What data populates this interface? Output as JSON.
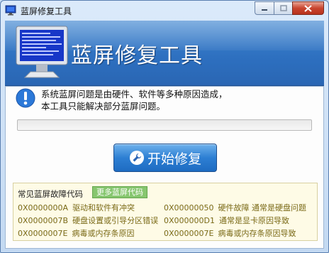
{
  "window": {
    "title": "蓝屏修复工具"
  },
  "banner": {
    "title": "蓝屏修复工具"
  },
  "info": {
    "line1": "系统蓝屏问题是由硬件、软件等多种原因造成，",
    "line2": "本工具只能解决部分蓝屏问题。"
  },
  "progress": {
    "value": 0
  },
  "start_button": {
    "label": "开始修复"
  },
  "codes": {
    "label": "常见蓝屏故障代码",
    "more_label": "更多蓝屏代码",
    "items": [
      {
        "code": "0X0000000A",
        "desc": "驱动和软件有冲突"
      },
      {
        "code": "0X00000050",
        "desc": "硬件故障 通常是硬盘问题"
      },
      {
        "code": "0X0000007B",
        "desc": "硬盘设置或引导分区错误"
      },
      {
        "code": "0X000000D1",
        "desc": "通常是显卡原因导致"
      },
      {
        "code": "0X0000007E",
        "desc": "病毒或内存条原因"
      },
      {
        "code": "0X0000007E",
        "desc": "病毒或内存条原因导致"
      }
    ]
  },
  "colors": {
    "accent": "#2d7fd3",
    "code_text": "#7a6a17",
    "more_button": "#86c66f"
  }
}
